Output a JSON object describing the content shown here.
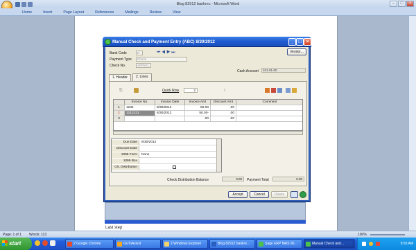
{
  "word": {
    "title": "Blog 82912 bankrec - Microsoft Word",
    "tabs": [
      "Home",
      "Insert",
      "Page Layout",
      "References",
      "Mailings",
      "Review",
      "View"
    ],
    "status": {
      "page": "Page: 1 of 1",
      "words": "Words: 113",
      "zoom": "100%"
    },
    "doc_text": "Last step"
  },
  "dialog": {
    "title": "Manual Check and Payment Entry (ABC) 8/30/2012",
    "labels": {
      "bank_code": "Bank Code",
      "payment_type": "Payment Type",
      "check_no": "Check No.",
      "cash_account": "Cash Account",
      "quick_row": "Quick Row"
    },
    "values": {
      "bank_code": "D",
      "payment_type": "Check",
      "check_no": "APP501",
      "cash_account": "101-01-00",
      "quick_row": "2"
    },
    "vendor_button": "Vendor...",
    "tabs": [
      {
        "label": "1. Header"
      },
      {
        "label": "2. Lines"
      }
    ],
    "grid": {
      "columns": [
        "Invoice No.",
        "Invoice Date",
        "Invoice Amt",
        "Discount Amt",
        "Comment"
      ],
      "rows": [
        {
          "n": "1",
          "invoice": "1234",
          "date": "8/30/2012",
          "amt": "50.00",
          "disc": ".00",
          "comment": ""
        },
        {
          "n": "2",
          "invoice": "1212121",
          "date": "8/30/2012",
          "amt": "50.00-",
          ".disc": "",
          "disc": ".00",
          "comment": ""
        },
        {
          "n": "3",
          "invoice": "",
          "date": "",
          "amt": ".00",
          "disc": ".00",
          "comment": ""
        }
      ]
    },
    "detail": [
      {
        "label": "Due Date",
        "value": "8/30/2012"
      },
      {
        "label": "Discount Date",
        "value": ""
      },
      {
        "label": "1099 Form",
        "value": "None"
      },
      {
        "label": "1099 Box",
        "value": ""
      },
      {
        "label": "G/L Distribution",
        "value": ""
      }
    ],
    "totals": {
      "check_dist_label": "Check Distribution Balance",
      "check_dist_value": "0.00",
      "payment_total_label": "Payment Total",
      "payment_total_value": "0.00"
    },
    "buttons": {
      "accept": "Accept",
      "cancel": "Cancel",
      "delete": "Delete"
    }
  },
  "taskbar": {
    "start": "start",
    "items": [
      "2 Google Chrome",
      "GoToAssist",
      "2 Windows Explorer",
      "Blog 82912 bankre...",
      "Sage ERP MAS 90...",
      "Manual Check and..."
    ],
    "clock": "9:50 AM"
  }
}
